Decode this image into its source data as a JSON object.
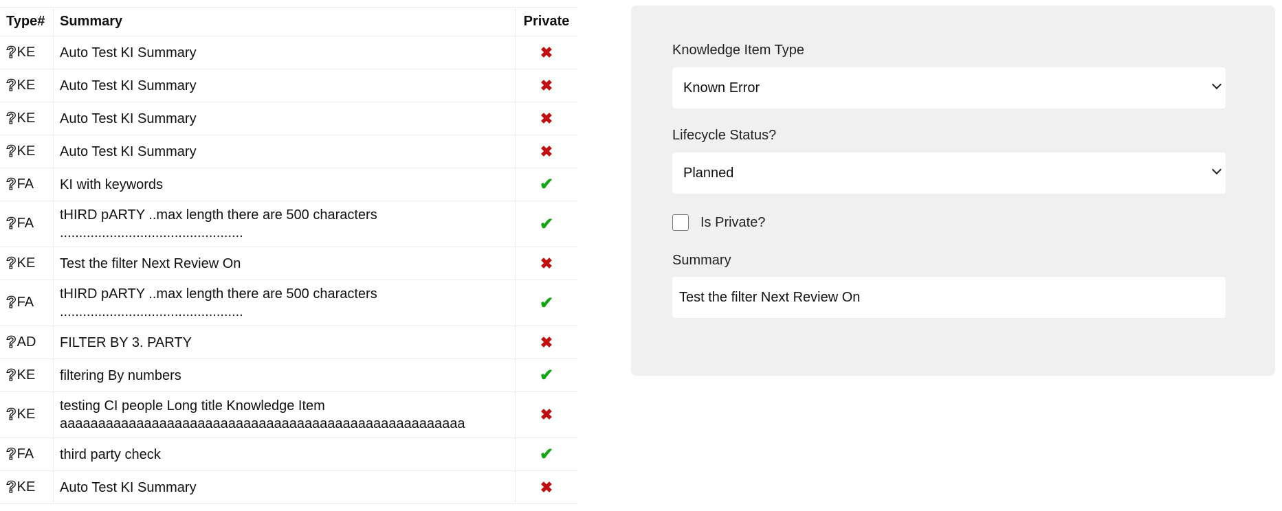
{
  "table": {
    "headers": {
      "type": "Type#",
      "summary": "Summary",
      "private": "Private"
    },
    "rows": [
      {
        "type": "KE",
        "summary": "Auto Test KI Summary",
        "private": false
      },
      {
        "type": "KE",
        "summary": "Auto Test KI Summary",
        "private": false
      },
      {
        "type": "KE",
        "summary": "Auto Test KI Summary",
        "private": false
      },
      {
        "type": "KE",
        "summary": "Auto Test KI Summary",
        "private": false
      },
      {
        "type": "FA",
        "summary": "KI with keywords",
        "private": true
      },
      {
        "type": "FA",
        "summary": "tHIRD pARTY ..max length there are 500 characters\n................................................",
        "private": true
      },
      {
        "type": "KE",
        "summary": "Test the filter Next Review On",
        "private": false
      },
      {
        "type": "FA",
        "summary": "tHIRD pARTY ..max length there are 500 characters\n................................................",
        "private": true
      },
      {
        "type": "AD",
        "summary": "FILTER BY 3. PARTY",
        "private": false
      },
      {
        "type": "KE",
        "summary": "filtering By numbers",
        "private": true
      },
      {
        "type": "KE",
        "summary": "testing CI people Long title Knowledge Item\naaaaaaaaaaaaaaaaaaaaaaaaaaaaaaaaaaaaaaaaaaaaaaaaaaaaa",
        "private": false
      },
      {
        "type": "FA",
        "summary": "third party check",
        "private": true
      },
      {
        "type": "KE",
        "summary": "Auto Test KI Summary",
        "private": false
      }
    ],
    "type_icon": "question-icon",
    "private_true_icon": "✔",
    "private_false_icon": "✖",
    "colors": {
      "true": "#13a613",
      "false": "#c01010"
    }
  },
  "form": {
    "ki_type_label": "Knowledge Item Type",
    "ki_type_value": "Known Error",
    "lifecycle_label": "Lifecycle Status?",
    "lifecycle_value": "Planned",
    "is_private_label": "Is Private?",
    "is_private_checked": false,
    "summary_label": "Summary",
    "summary_value": "Test the filter Next Review On"
  }
}
